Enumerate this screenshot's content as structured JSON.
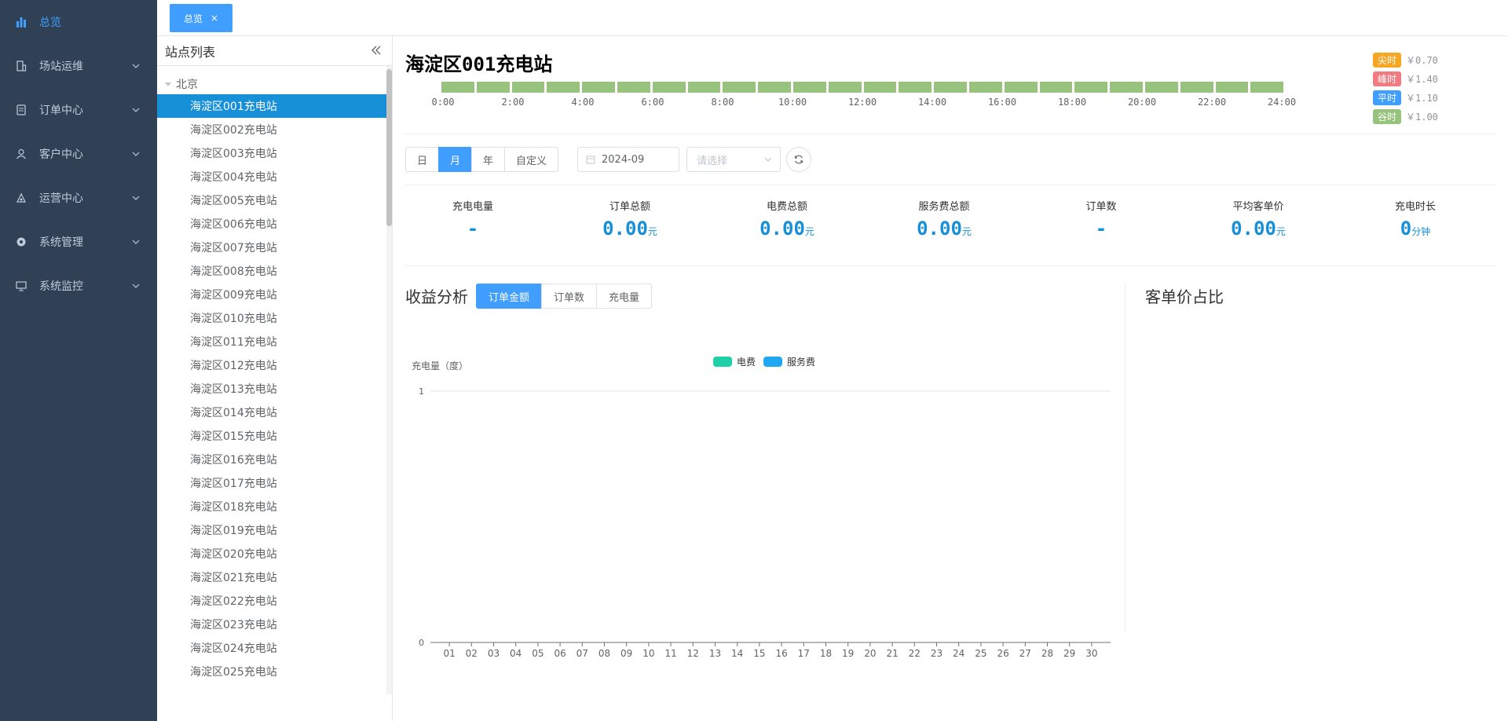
{
  "sidebar": {
    "items": [
      {
        "label": "总览",
        "icon": "bar-chart-icon",
        "active": true
      },
      {
        "label": "场站运维",
        "icon": "building-icon"
      },
      {
        "label": "订单中心",
        "icon": "order-icon"
      },
      {
        "label": "客户中心",
        "icon": "user-icon"
      },
      {
        "label": "运营中心",
        "icon": "operate-icon"
      },
      {
        "label": "系统管理",
        "icon": "gear-icon"
      },
      {
        "label": "系统监控",
        "icon": "monitor-icon"
      }
    ]
  },
  "tabs": {
    "active": "总览",
    "close": "×"
  },
  "stations": {
    "title": "站点列表",
    "city": "北京",
    "items": [
      "海淀区001充电站",
      "海淀区002充电站",
      "海淀区003充电站",
      "海淀区004充电站",
      "海淀区005充电站",
      "海淀区006充电站",
      "海淀区007充电站",
      "海淀区008充电站",
      "海淀区009充电站",
      "海淀区010充电站",
      "海淀区011充电站",
      "海淀区012充电站",
      "海淀区013充电站",
      "海淀区014充电站",
      "海淀区015充电站",
      "海淀区016充电站",
      "海淀区017充电站",
      "海淀区018充电站",
      "海淀区019充电站",
      "海淀区020充电站",
      "海淀区021充电站",
      "海淀区022充电站",
      "海淀区023充电站",
      "海淀区024充电站",
      "海淀区025充电站"
    ],
    "selected": 0
  },
  "main": {
    "title": "海淀区001充电站",
    "time_labels": [
      "0:00",
      "2:00",
      "4:00",
      "6:00",
      "8:00",
      "10:00",
      "12:00",
      "14:00",
      "16:00",
      "18:00",
      "20:00",
      "22:00",
      "24:00"
    ],
    "price_legend": [
      {
        "tag": "尖时",
        "price": "￥0.70",
        "color": "#f5a623"
      },
      {
        "tag": "峰时",
        "price": "￥1.40",
        "color": "#f07c82"
      },
      {
        "tag": "平时",
        "price": "￥1.10",
        "color": "#409eff"
      },
      {
        "tag": "谷时",
        "price": "￥1.00",
        "color": "#98c37e"
      }
    ],
    "segment_color": "#98c37e",
    "period_buttons": [
      "日",
      "月",
      "年",
      "自定义"
    ],
    "period_active": "月",
    "date_value": "2024-09",
    "select_placeholder": "请选择",
    "stats": [
      {
        "label": "充电电量",
        "value": "-",
        "unit": ""
      },
      {
        "label": "订单总额",
        "value": "0.00",
        "unit": "元"
      },
      {
        "label": "电费总额",
        "value": "0.00",
        "unit": "元"
      },
      {
        "label": "服务费总额",
        "value": "0.00",
        "unit": "元"
      },
      {
        "label": "订单数",
        "value": "-",
        "unit": ""
      },
      {
        "label": "平均客单价",
        "value": "0.00",
        "unit": "元"
      },
      {
        "label": "充电时长",
        "value": "0",
        "unit": "分钟"
      }
    ],
    "revenue_title": "收益分析",
    "chart_tabs": [
      "订单金额",
      "订单数",
      "充电量"
    ],
    "chart_tab_active": "订单金额",
    "pie_title": "客单价占比"
  },
  "chart_data": {
    "type": "bar",
    "title": "",
    "ylabel": "充电量（度）",
    "xlabel": "",
    "categories": [
      "01",
      "02",
      "03",
      "04",
      "05",
      "06",
      "07",
      "08",
      "09",
      "10",
      "11",
      "12",
      "13",
      "14",
      "15",
      "16",
      "17",
      "18",
      "19",
      "20",
      "21",
      "22",
      "23",
      "24",
      "25",
      "26",
      "27",
      "28",
      "29",
      "30"
    ],
    "series": [
      {
        "name": "电费",
        "color": "#1fcfa6",
        "values": [
          0,
          0,
          0,
          0,
          0,
          0,
          0,
          0,
          0,
          0,
          0,
          0,
          0,
          0,
          0,
          0,
          0,
          0,
          0,
          0,
          0,
          0,
          0,
          0,
          0,
          0,
          0,
          0,
          0,
          0
        ]
      },
      {
        "name": "服务费",
        "color": "#1ea8f3",
        "values": [
          0,
          0,
          0,
          0,
          0,
          0,
          0,
          0,
          0,
          0,
          0,
          0,
          0,
          0,
          0,
          0,
          0,
          0,
          0,
          0,
          0,
          0,
          0,
          0,
          0,
          0,
          0,
          0,
          0,
          0
        ]
      }
    ],
    "ylim": [
      0,
      1
    ],
    "yticks": [
      "0",
      "1"
    ],
    "grid": true,
    "legend": "top-center"
  }
}
